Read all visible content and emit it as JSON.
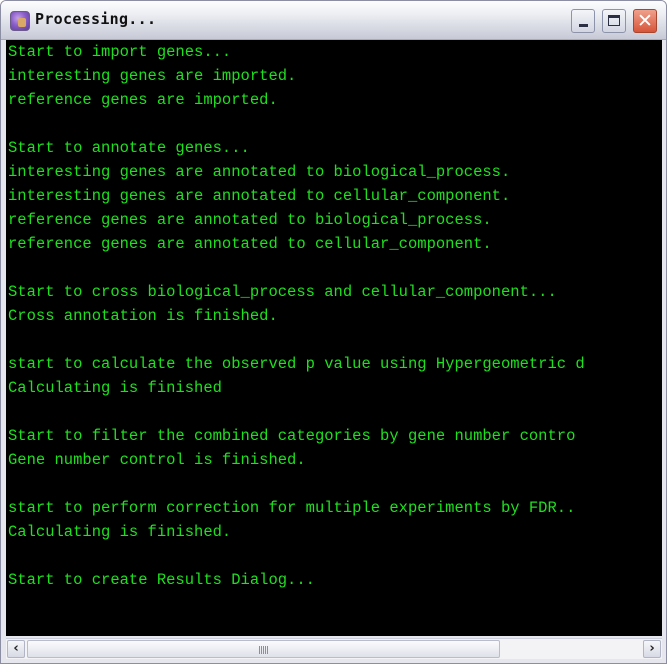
{
  "window": {
    "title": "Processing...",
    "icon": "app-icon",
    "controls": {
      "minimize": "minimize-icon",
      "maximize": "maximize-icon",
      "close": "close-icon",
      "close_glyph": "✕"
    }
  },
  "console": {
    "text_color": "#1fe01f",
    "background": "#000000",
    "lines": [
      "Start to import genes...",
      "interesting genes are imported.",
      "reference genes are imported.",
      "",
      "Start to annotate genes...",
      "interesting genes are annotated to biological_process.",
      "interesting genes are annotated to cellular_component.",
      "reference genes are annotated to biological_process.",
      "reference genes are annotated to cellular_component.",
      "",
      "Start to cross biological_process and cellular_component...",
      "Cross annotation is finished.",
      "",
      "start to calculate the observed p value using Hypergeometric d",
      "Calculating is finished",
      "",
      "Start to filter the combined categories by gene number contro",
      "Gene number control is finished.",
      "",
      "start to perform correction for multiple experiments by FDR..",
      "Calculating is finished.",
      "",
      "Start to create Results Dialog..."
    ]
  },
  "scrollbar": {
    "left_arrow": "‹",
    "right_arrow": "›",
    "thumb_fraction_visible": 0.77,
    "scroll_position": 0
  }
}
